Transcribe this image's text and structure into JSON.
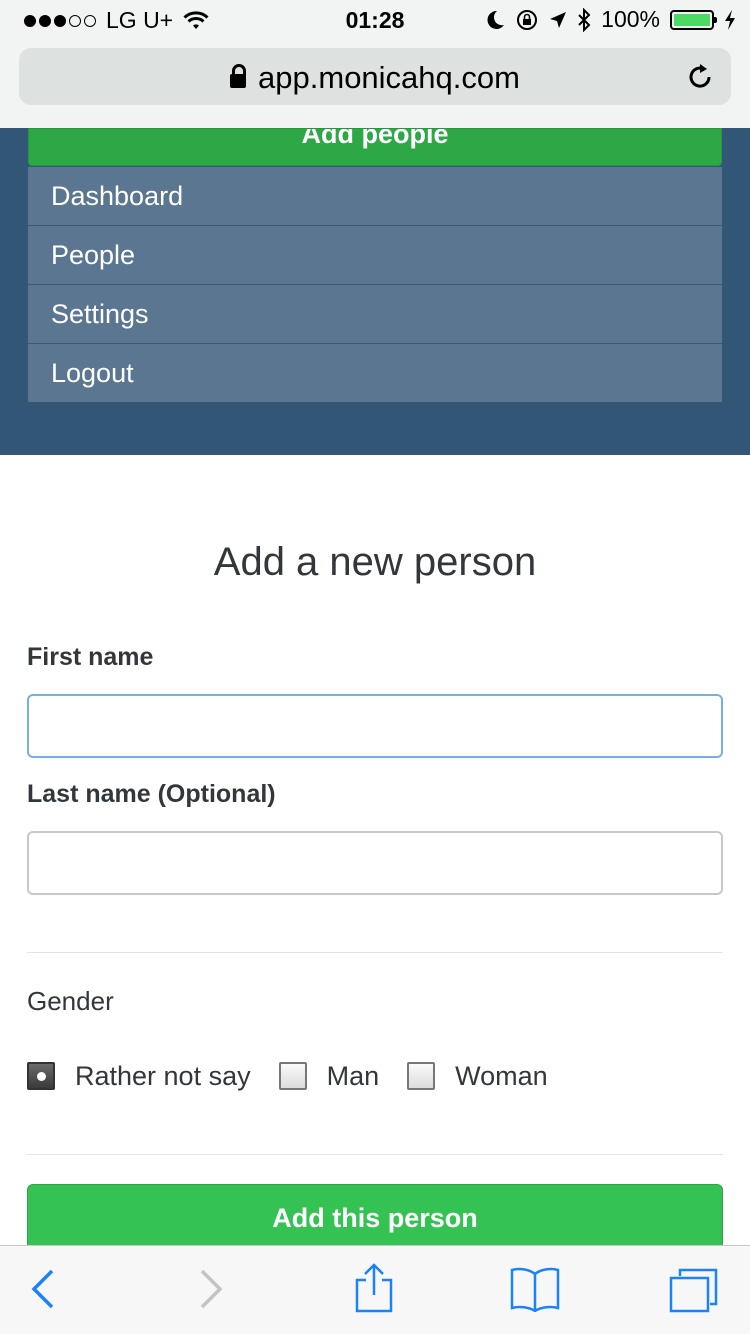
{
  "status_bar": {
    "carrier": "LG U+",
    "time": "01:28",
    "battery": "100%",
    "battery_level": 1.0,
    "icons": [
      "wifi-icon",
      "moon-icon",
      "orientation-lock-icon",
      "location-icon",
      "bluetooth-icon",
      "charging-icon"
    ]
  },
  "browser": {
    "url": "app.monicahq.com",
    "icons": [
      "lock-icon",
      "reload-icon",
      "back-icon",
      "forward-icon",
      "share-icon",
      "bookmarks-icon",
      "tabs-icon"
    ]
  },
  "nav": {
    "add_people_label": "Add people",
    "items": [
      {
        "label": "Dashboard"
      },
      {
        "label": "People"
      },
      {
        "label": "Settings"
      },
      {
        "label": "Logout"
      }
    ]
  },
  "form": {
    "title": "Add a new person",
    "first_name_label": "First name",
    "first_name_value": "",
    "last_name_label": "Last name (Optional)",
    "last_name_value": "",
    "gender_label": "Gender",
    "gender_options": [
      {
        "label": "Rather not say",
        "checked": true
      },
      {
        "label": "Man",
        "checked": false
      },
      {
        "label": "Woman",
        "checked": false
      }
    ],
    "submit_label": "Add this person"
  },
  "colors": {
    "nav_background": "#325776",
    "nav_item": "#5a7690",
    "green_button": "#34c353",
    "ios_blue": "#1a82fb"
  }
}
